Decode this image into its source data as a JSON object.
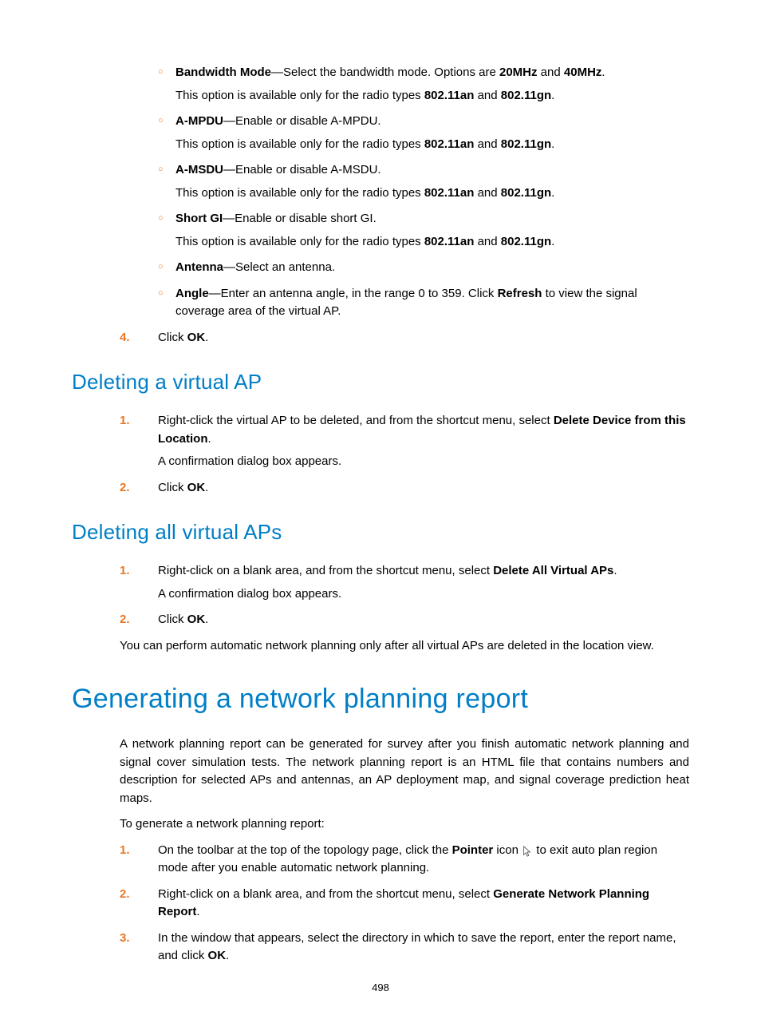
{
  "sub_items": [
    {
      "label": "Bandwidth Mode",
      "desc_before": "—Select the bandwidth mode. Options are ",
      "opts": [
        "20MHz",
        " and ",
        "40MHz",
        "."
      ],
      "note_pre": "This option is available only for the radio types ",
      "n1": "802.11an",
      "n_and": " and ",
      "n2": "802.11gn",
      "note_post": "."
    },
    {
      "label": "A-MPDU",
      "desc_before": "—Enable or disable A-MPDU.",
      "opts": [],
      "note_pre": "This option is available only for the radio types ",
      "n1": "802.11an",
      "n_and": " and ",
      "n2": "802.11gn",
      "note_post": "."
    },
    {
      "label": "A-MSDU",
      "desc_before": "—Enable or disable A-MSDU.",
      "opts": [],
      "note_pre": "This option is available only for the radio types ",
      "n1": "802.11an",
      "n_and": " and ",
      "n2": "802.11gn",
      "note_post": "."
    },
    {
      "label": "Short GI",
      "desc_before": "—Enable or disable short GI.",
      "opts": [],
      "note_pre": "This option is available only for the radio types ",
      "n1": "802.11an",
      "n_and": " and ",
      "n2": "802.11gn",
      "note_post": "."
    },
    {
      "label": "Antenna",
      "desc_before": "—Select an antenna.",
      "opts": [],
      "note_pre": "",
      "n1": "",
      "n_and": "",
      "n2": "",
      "note_post": ""
    },
    {
      "label": "Angle",
      "desc_before": "—Enter an antenna angle, in the range 0 to 359. Click ",
      "opts": [
        "Refresh",
        " to view the signal coverage area of the virtual AP."
      ],
      "note_pre": "",
      "n1": "",
      "n_and": "",
      "n2": "",
      "note_post": ""
    }
  ],
  "step4_num": "4.",
  "step4_pre": "Click ",
  "step4_bold": "OK",
  "step4_post": ".",
  "h2_del_vap": "Deleting a virtual AP",
  "del_vap_1_num": "1.",
  "del_vap_1_pre": "Right-click the virtual AP to be deleted, and from the shortcut menu, select ",
  "del_vap_1_bold": "Delete Device from this Location",
  "del_vap_1_post": ".",
  "del_vap_1_note": "A confirmation dialog box appears.",
  "del_vap_2_num": "2.",
  "del_vap_2_pre": "Click ",
  "del_vap_2_bold": "OK",
  "del_vap_2_post": ".",
  "h2_del_all": "Deleting all virtual APs",
  "del_all_1_num": "1.",
  "del_all_1_pre": "Right-click on a blank area, and from the shortcut menu, select ",
  "del_all_1_bold": "Delete All Virtual APs",
  "del_all_1_post": ".",
  "del_all_1_note": "A confirmation dialog box appears.",
  "del_all_2_num": "2.",
  "del_all_2_pre": "Click ",
  "del_all_2_bold": "OK",
  "del_all_2_post": ".",
  "del_all_para": "You can perform automatic network planning only after all virtual APs are deleted in the location view.",
  "h1_gen": "Generating a network planning report",
  "gen_para1": "A network planning report can be generated for survey after you finish automatic network planning and signal cover simulation tests. The network planning report is an HTML file that contains numbers and description for selected APs and antennas, an AP deployment map, and signal coverage prediction heat maps.",
  "gen_para2": "To generate a network planning report:",
  "gen_1_num": "1.",
  "gen_1_pre": "On the toolbar at the top of the topology page, click the ",
  "gen_1_bold": "Pointer",
  "gen_1_mid": " icon ",
  "gen_1_post": " to exit auto plan region mode after you enable automatic network planning.",
  "gen_2_num": "2.",
  "gen_2_pre": "Right-click on a blank area, and from the shortcut menu, select ",
  "gen_2_bold": "Generate Network Planning Report",
  "gen_2_post": ".",
  "gen_3_num": "3.",
  "gen_3_pre": "In the window that appears, select the directory in which to save the report, enter the report name, and click ",
  "gen_3_bold": "OK",
  "gen_3_post": ".",
  "page_num": "498",
  "circ": "○"
}
